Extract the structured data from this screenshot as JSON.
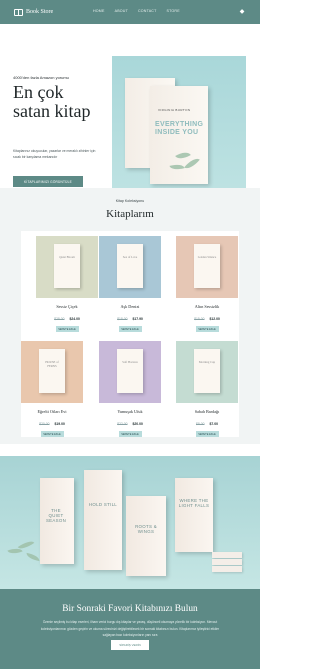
{
  "header": {
    "logo_text": "Book Store",
    "nav": [
      "HOME",
      "ABOUT",
      "CONTACT",
      "STORE"
    ],
    "social_icon": "social-icon"
  },
  "hero": {
    "count_text": "4000'den fazla Amazon yorumu",
    "title": "En çok satan kitap",
    "description": "Kitaplarınız okuyucular, yazarlar ve meraklı zihinler için sıcak bir karşılama mekanıdır",
    "cta_label": "KİTAPLARIMIZI GÖRÜNTÜLE",
    "image": {
      "book_author": "VIRGINIA BURTON",
      "book_title": "EVERYTHING INSIDE YOU"
    }
  },
  "collection": {
    "subtitle": "Kitap Koleksiyonu",
    "title": "Kitaplarım",
    "cards": [
      {
        "name": "Sessiz Çiçek",
        "old_price": "$28.00",
        "new_price": "$24.00",
        "button": "SEPETE EKLE",
        "cover_bg": "#d8dcc6",
        "cover_title": "Quiet Bloom"
      },
      {
        "name": "Aşk Denizi",
        "old_price": "$18.00",
        "new_price": "$17.90",
        "button": "SEPETE EKLE",
        "cover_bg": "#a9c7d6",
        "cover_title": "Sea of Love"
      },
      {
        "name": "Altın Sessizlik",
        "old_price": "$15.00",
        "new_price": "$12.00",
        "button": "SEPETE EKLE",
        "cover_bg": "#e6c7b5",
        "cover_title": "Golden Silence"
      },
      {
        "name": "Eğrelti Otları Evi",
        "old_price": "$20.00",
        "new_price": "$19.00",
        "button": "SEPETE EKLE",
        "cover_bg": "#e9c7ad",
        "cover_title": "HOUSE of FERNS"
      },
      {
        "name": "Yumuşak Ufuk",
        "old_price": "$22.00",
        "new_price": "$20.00",
        "button": "SEPETE EKLE",
        "cover_bg": "#c8b9d9",
        "cover_title": "Soft Horizon"
      },
      {
        "name": "Sabah Bardağı",
        "old_price": "$8.00",
        "new_price": "$7.00",
        "button": "SEPETE EKLE",
        "cover_bg": "#c4dcd2",
        "cover_title": "Morning Cup"
      }
    ]
  },
  "banner": {
    "books": [
      "THE QUIET SEASON",
      "HOLD STILL",
      "ROOTS & WINGS",
      "WHERE THE LIGHT FALLS"
    ]
  },
  "footer_cta": {
    "title": "Bir Sonraki Favori Kitabınızı Bulun",
    "text": "Özenle seçilmiş bu kitap eserleri, ilham verici burgu dış kitaplar ve yavaş, düşünceli okumaya yönelik bir koleksiyon. Mevcut koleksiyonlarımızı gözden geçirin ve okuma sürecinizi değiştirebilecek bir sonraki kitabınızı bulun. Kitaplarımız iyileştirici etkiler sağlayan bazı koleksiyonların yanı sıra",
    "button": "SİPARİŞ VERİN"
  },
  "colors": {
    "brand": "#5d8a86",
    "accent_light": "#b8dcdc",
    "text_dark": "#1f2628"
  }
}
